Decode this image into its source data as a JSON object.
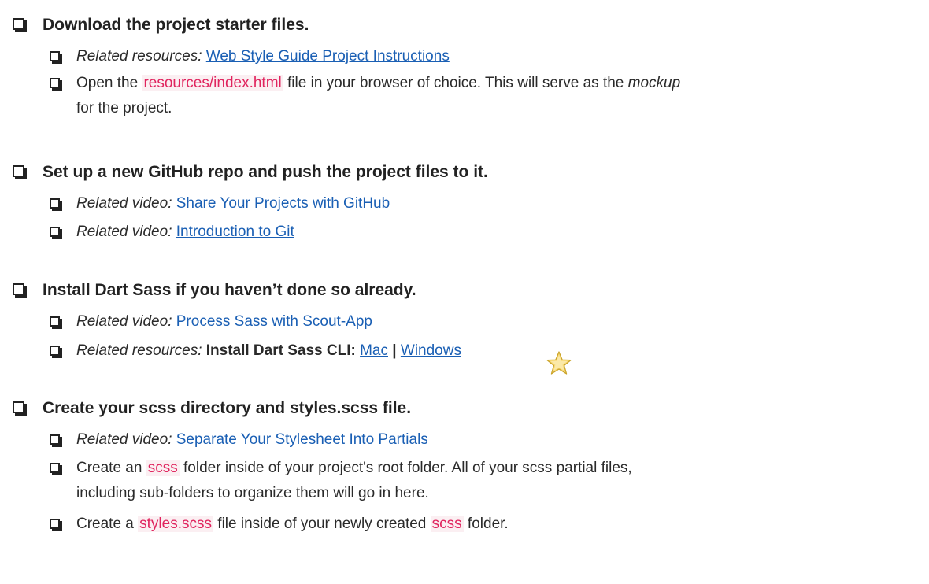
{
  "sections": [
    {
      "title": "Download the project starter files.",
      "items": [
        {
          "prefix": "Related resources:",
          "link": "Web Style Guide Project Instructions"
        },
        {
          "t1": "Open the ",
          "code": "resources/index.html",
          "t2": " file in your browser of choice. This will serve as the ",
          "em": "mockup",
          "t3": "for the project."
        }
      ]
    },
    {
      "title": "Set up a new GitHub repo and push the project files to it.",
      "items": [
        {
          "prefix": "Related video:",
          "link": "Share Your Projects with GitHub"
        },
        {
          "prefix": "Related video:",
          "link": "Introduction to Git"
        }
      ]
    },
    {
      "title": "Install Dart Sass if you haven’t done so already.",
      "items": [
        {
          "prefix": "Related video:",
          "link": "Process Sass with Scout-App"
        },
        {
          "prefix": "Related resources:",
          "bold": "Install Dart Sass CLI:",
          "link_mac": "Mac",
          "sep": "|",
          "link_win": "Windows"
        }
      ]
    },
    {
      "title": "Create your scss directory and styles.scss file.",
      "items": [
        {
          "prefix": "Related video:",
          "link": "Separate Your Stylesheet Into Partials"
        },
        {
          "t1": "Create an ",
          "code": "scss",
          "t2": " folder inside of your project's root folder. All of your scss partial files,",
          "t3": "including sub-folders to organize them will go in here."
        },
        {
          "t1": "Create a ",
          "code": "styles.scss",
          "t2": " file inside of your newly created ",
          "code2": "scss",
          "t3": " folder."
        }
      ]
    }
  ],
  "icons": {
    "checkbox": "checkbox-icon",
    "star": "star-icon"
  },
  "colors": {
    "link": "#1a5fb4",
    "code": "#e0245e",
    "star_fill": "#f7d774",
    "star_stroke": "#c9a227"
  }
}
